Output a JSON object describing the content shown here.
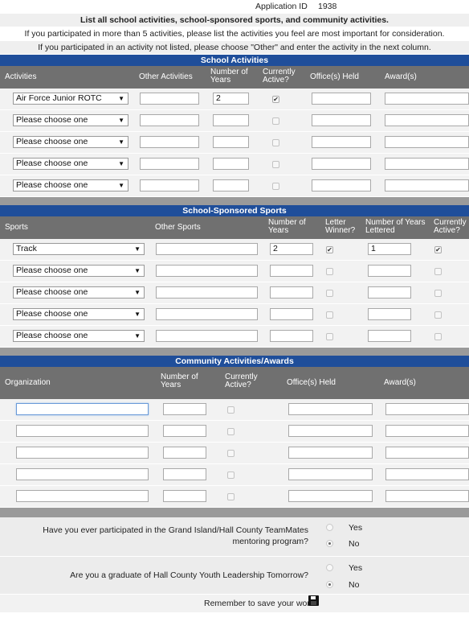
{
  "header": {
    "app_id_label": "Application ID",
    "app_id_value": "1938",
    "instruction_bold": "List all school activities, school-sponsored sports, and community activities.",
    "instruction_2": "If you participated in more than 5 activities, please list the activities you feel are most important for consideration.",
    "instruction_3": "If you participated in an activity not listed, please choose \"Other\" and enter the activity in the next column."
  },
  "school_activities": {
    "title": "School Activities",
    "columns": [
      "Activities",
      "Other Activities",
      "Number of Years",
      "Currently Active?",
      "Office(s) Held",
      "Award(s)"
    ],
    "rows": [
      {
        "activity": "Air Force Junior ROTC",
        "other": "",
        "years": "2",
        "active": true,
        "office": "",
        "award": ""
      },
      {
        "activity": "Please choose one",
        "other": "",
        "years": "",
        "active": false,
        "office": "",
        "award": ""
      },
      {
        "activity": "Please choose one",
        "other": "",
        "years": "",
        "active": false,
        "office": "",
        "award": ""
      },
      {
        "activity": "Please choose one",
        "other": "",
        "years": "",
        "active": false,
        "office": "",
        "award": ""
      },
      {
        "activity": "Please choose one",
        "other": "",
        "years": "",
        "active": false,
        "office": "",
        "award": ""
      }
    ]
  },
  "sports": {
    "title": "School-Sponsored Sports",
    "columns": [
      "Sports",
      "Other Sports",
      "Number of Years",
      "Letter Winner?",
      "Number of Years Lettered",
      "Currently Active?"
    ],
    "rows": [
      {
        "sport": "Track",
        "other": "",
        "years": "2",
        "letter": true,
        "years_lettered": "1",
        "active": true
      },
      {
        "sport": "Please choose one",
        "other": "",
        "years": "",
        "letter": false,
        "years_lettered": "",
        "active": false
      },
      {
        "sport": "Please choose one",
        "other": "",
        "years": "",
        "letter": false,
        "years_lettered": "",
        "active": false
      },
      {
        "sport": "Please choose one",
        "other": "",
        "years": "",
        "letter": false,
        "years_lettered": "",
        "active": false
      },
      {
        "sport": "Please choose one",
        "other": "",
        "years": "",
        "letter": false,
        "years_lettered": "",
        "active": false
      }
    ]
  },
  "community": {
    "title": "Community Activities/Awards",
    "columns": [
      "Organization",
      "Number of Years",
      "Currently Active?",
      "Office(s) Held",
      "Award(s)"
    ],
    "rows": [
      {
        "org": "",
        "years": "",
        "active": false,
        "office": "",
        "award": ""
      },
      {
        "org": "",
        "years": "",
        "active": false,
        "office": "",
        "award": ""
      },
      {
        "org": "",
        "years": "",
        "active": false,
        "office": "",
        "award": ""
      },
      {
        "org": "",
        "years": "",
        "active": false,
        "office": "",
        "award": ""
      },
      {
        "org": "",
        "years": "",
        "active": false,
        "office": "",
        "award": ""
      }
    ]
  },
  "questions": [
    {
      "text_line1": "Have you ever participated in the Grand Island/Hall County TeamMates",
      "text_line2": "mentoring program?",
      "yes": "Yes",
      "no": "No",
      "selected": "No"
    },
    {
      "text_line1": "Are you a graduate of Hall County Youth Leadership Tomorrow?",
      "text_line2": "",
      "yes": "Yes",
      "no": "No",
      "selected": "No"
    }
  ],
  "footer": {
    "text": "Remember to save your work",
    "icon": "save-icon"
  }
}
